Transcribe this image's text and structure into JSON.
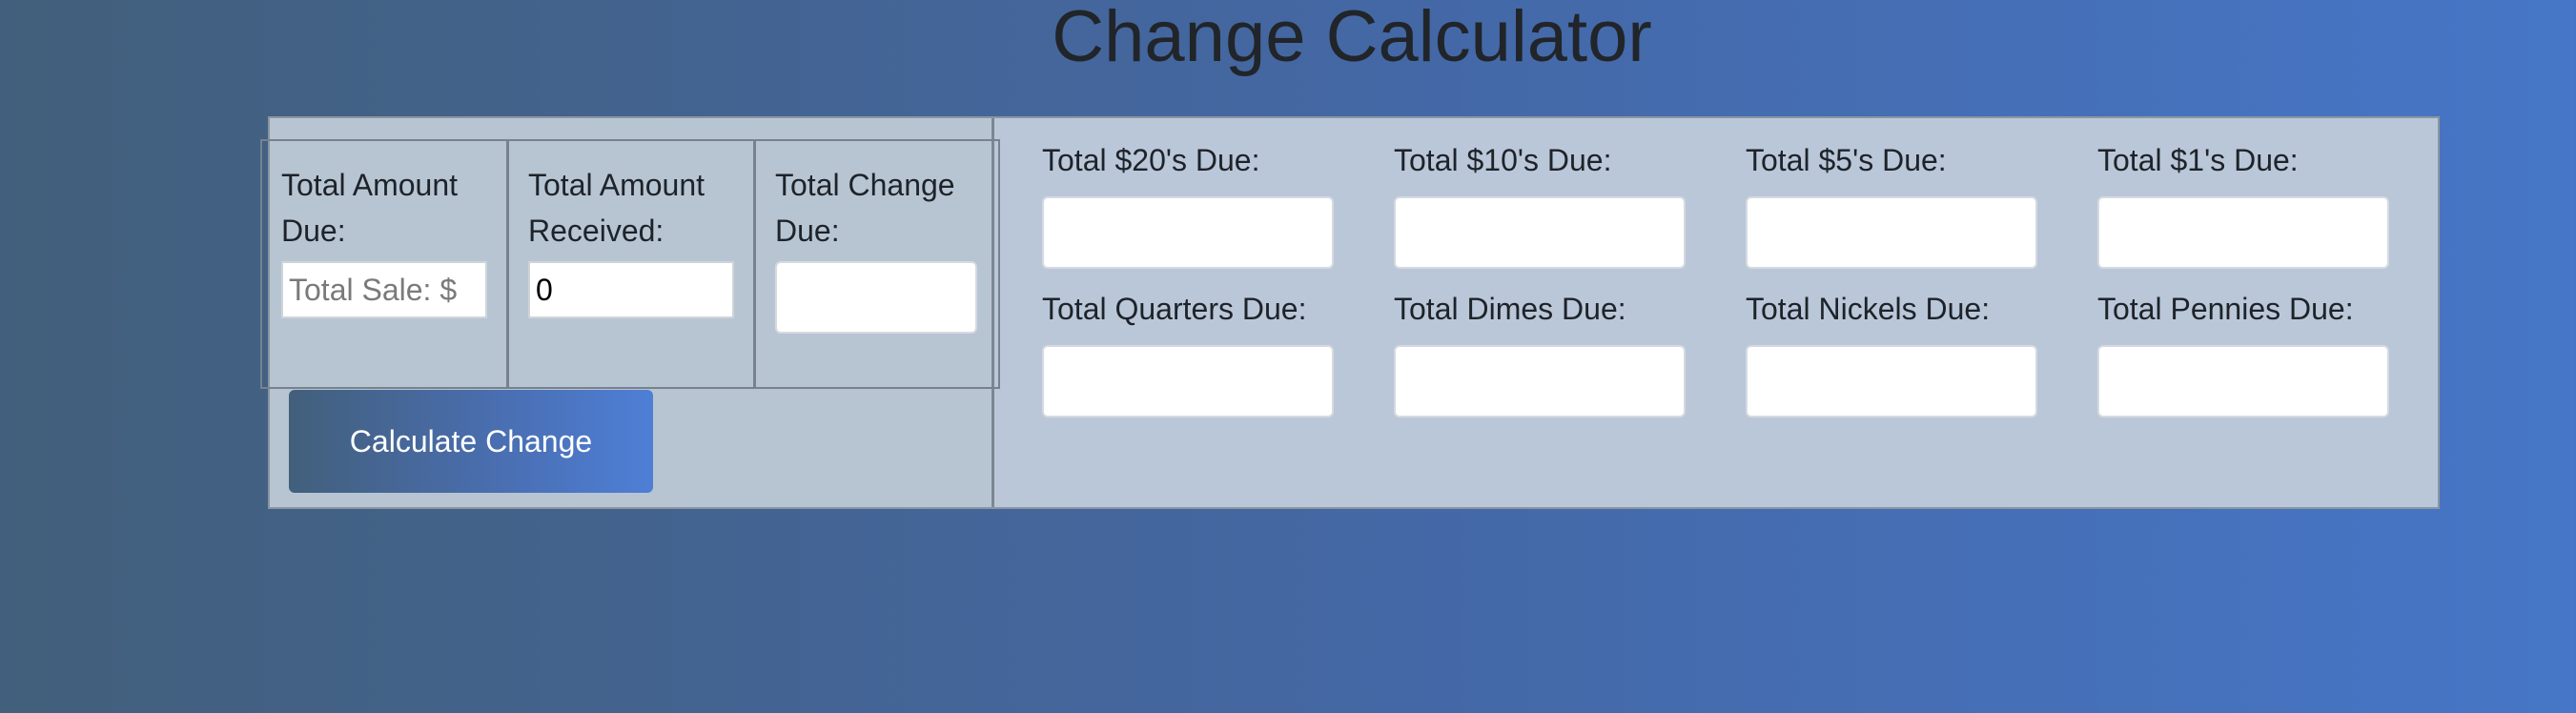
{
  "page": {
    "title": "Change Calculator"
  },
  "inputs": {
    "amount_due": {
      "label": "Total Amount Due:",
      "placeholder": "Total Sale: $",
      "value": ""
    },
    "amount_received": {
      "label": "Total Amount Received:",
      "value": "0"
    },
    "change_due": {
      "label": "Total Change Due:",
      "value": ""
    }
  },
  "actions": {
    "calculate_label": "Calculate Change"
  },
  "denominations": [
    {
      "label": "Total $20's Due:",
      "value": ""
    },
    {
      "label": "Total $10's Due:",
      "value": ""
    },
    {
      "label": "Total $5's Due:",
      "value": ""
    },
    {
      "label": "Total $1's Due:",
      "value": ""
    },
    {
      "label": "Total Quarters Due:",
      "value": ""
    },
    {
      "label": "Total Dimes Due:",
      "value": ""
    },
    {
      "label": "Total Nickels Due:",
      "value": ""
    },
    {
      "label": "Total Pennies Due:",
      "value": ""
    }
  ],
  "colors": {
    "background_start": "#425f7b",
    "background_end": "#4676c7",
    "panel": "#b9c7d9",
    "button_text": "#ffffff"
  }
}
